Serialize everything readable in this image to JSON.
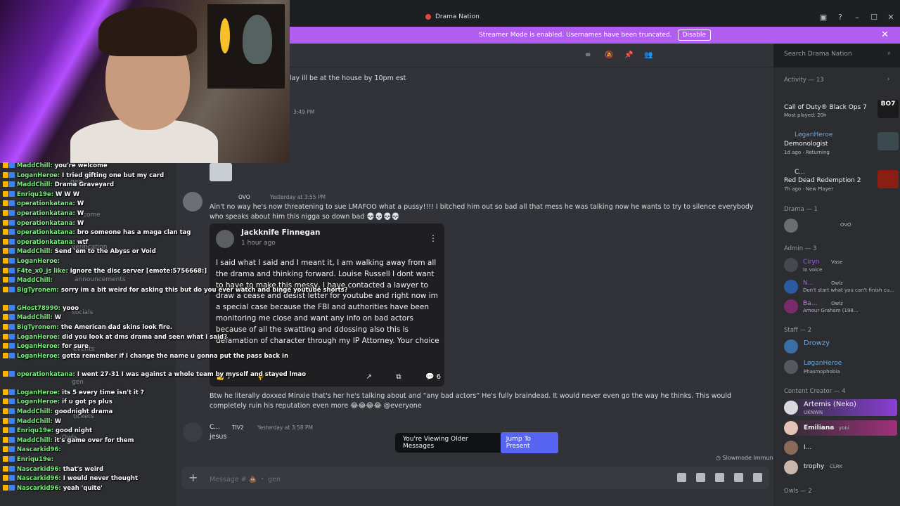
{
  "window": {
    "title": "Drama Nation",
    "controls": [
      "inbox-icon",
      "help-icon",
      "minimize-icon",
      "maximize-icon",
      "close-icon"
    ]
  },
  "banner": {
    "text": "Streamer Mode is enabled. Usernames have been truncated.",
    "button": "Disable"
  },
  "search": {
    "placeholder": "Search Drama Nation"
  },
  "channels": [
    "gen",
    "come",
    "verification",
    "announcements",
    "socials",
    "notifications",
    "events",
    "tickets",
    "gen",
    "Owls"
  ],
  "messages": {
    "m0_text": "lay ill be at the house by 10pm est",
    "m0_time": "3:49 PM",
    "m1_badge": "OVO",
    "m1_time": "Yesterday at 3:55 PM",
    "m1_text": "Ain't no way he's now threatening to sue LMAFOO what a pussy!!!! I bitched him out so bad all that mess he was talking now he wants to try to silence everybody who speaks about him this nigga so down bad 💀💀💀💀",
    "embed": {
      "author": "Jackknife Finnegan",
      "ago": "1 hour ago",
      "body": "I said what I said and I meant it, I am walking away from all the drama and thinking forward. Louise Russell I dont want to have to make this messy, I have contacted a lawyer to draw a cease and desist letter for youtube and right now im a special case because the FBI and authorities have been monitoring me close and want any info on bad actors because of all the swatting and ddossing also this is defamation of character through my IP Attorney. Your choice",
      "likes": "7",
      "comments": "6"
    },
    "m2_text": "Btw he literally doxxed Minxie that's her he's talking about and “any bad actors” He's fully braindead. It would never even go the way he thinks. This would completely ruin his reputation even more 😂😂😂😂 @everyone",
    "m3_user": "C...",
    "m3_tag": "TIV2",
    "m3_time": "Yesterday at 3:58 PM",
    "m3_text": "jesus"
  },
  "older": {
    "label": "You're Viewing Older Messages",
    "button": "Jump To Present"
  },
  "slowmode": "Slowmode Immune",
  "composer": {
    "placeholder": "Message # 💩 ・ gen"
  },
  "members": {
    "activity_header": "Activity — 13",
    "activities": [
      {
        "user": "",
        "game": "Call of Duty® Black Ops 7",
        "sub": "Most played: 20h",
        "art": "BO7"
      },
      {
        "user": "LøganHeroe",
        "game": "Demonologist",
        "sub": "1d ago · Returning"
      },
      {
        "user": "C...",
        "game": "Red Dead Redemption 2",
        "sub": "7h ago · New Player"
      }
    ],
    "drama_header": "Drama — 1",
    "drama_tag": "OVO",
    "admin_header": "Admin — 3",
    "admins": [
      {
        "name": "Ciryn",
        "tag": "Vase",
        "sub": "In voice"
      },
      {
        "name": "N...",
        "tag": "Owlz",
        "sub": "Don't start what you can't finish cu..."
      },
      {
        "name": "Ba...",
        "tag": "Owlz",
        "sub": "Amour Graham (198..."
      }
    ],
    "staff_header": "Staff — 2",
    "staff": [
      {
        "name": "Drowzy",
        "sub": ""
      },
      {
        "name": "LøganHeroe",
        "sub": "Phasmophobia"
      }
    ],
    "creator_header": "Content Creator — 4",
    "creators": [
      {
        "name": "Artemis (Neko)",
        "sub": "UKNWN"
      },
      {
        "name": "Emiliana",
        "tag": "yoni",
        "sub": ""
      },
      {
        "name": "I...",
        "sub": ""
      },
      {
        "name": "trophy",
        "tag": "CLRK",
        "sub": ""
      }
    ],
    "owls_header": "Owls — 2"
  },
  "stream_chat": [
    {
      "u": "MaddChill:",
      "t": "you're welcome"
    },
    {
      "u": "LoganHeroe:",
      "t": "I tried gifting one but my card"
    },
    {
      "u": "MaddChill:",
      "t": "Drama Graveyard"
    },
    {
      "u": "Enriqu19e:",
      "t": "W W W"
    },
    {
      "u": "operationkatana:",
      "t": "W"
    },
    {
      "u": "operationkatana:",
      "t": "W"
    },
    {
      "u": "operationkatana:",
      "t": "W"
    },
    {
      "u": "operationkatana:",
      "t": "bro someone has a maga clan tag"
    },
    {
      "u": "operationkatana:",
      "t": "wtf"
    },
    {
      "u": "MaddChill:",
      "t": "Send 'em to the Abyss or Void"
    },
    {
      "u": "LoganHeroe:",
      "t": ""
    },
    {
      "u": "F4te_x0_js like:",
      "t": "ignore the disc server [emote:5756668:]"
    },
    {
      "u": "MaddChill:",
      "t": ""
    },
    {
      "u": "BigTyronem:",
      "t": "sorry im a bit weird for asking this but do you ever watch and binge youtube shorts?"
    },
    {
      "u": "GHost78990:",
      "t": "yooo"
    },
    {
      "u": "MaddChill:",
      "t": "W"
    },
    {
      "u": "BigTyronem:",
      "t": "the American dad skins look fire."
    },
    {
      "u": "LoganHeroe:",
      "t": "did you look at dms drama and seen what I said?"
    },
    {
      "u": "LoganHeroe:",
      "t": "for sure"
    },
    {
      "u": "LoganHeroe:",
      "t": "gotta remember if I change the name u gonna put the pass back in"
    },
    {
      "u": "operationkatana:",
      "t": "I went 27-31 I was against a whole team by myself and stayed lmao"
    },
    {
      "u": "LoganHeroe:",
      "t": "its 5 every time isn't it ?"
    },
    {
      "u": "LoganHeroe:",
      "t": "if u got ps plus"
    },
    {
      "u": "MaddChill:",
      "t": "goodnight drama"
    },
    {
      "u": "MaddChill:",
      "t": "W"
    },
    {
      "u": "Enriqu19e:",
      "t": "good night"
    },
    {
      "u": "MaddChill:",
      "t": "it's game over for them"
    },
    {
      "u": "Nascarkid96:",
      "t": ""
    },
    {
      "u": "Enriqu19e:",
      "t": ""
    },
    {
      "u": "Nascarkid96:",
      "t": "that's weird"
    },
    {
      "u": "Nascarkid96:",
      "t": "I would never thought"
    },
    {
      "u": "Nascarkid96:",
      "t": "yeah 'quite'"
    }
  ]
}
